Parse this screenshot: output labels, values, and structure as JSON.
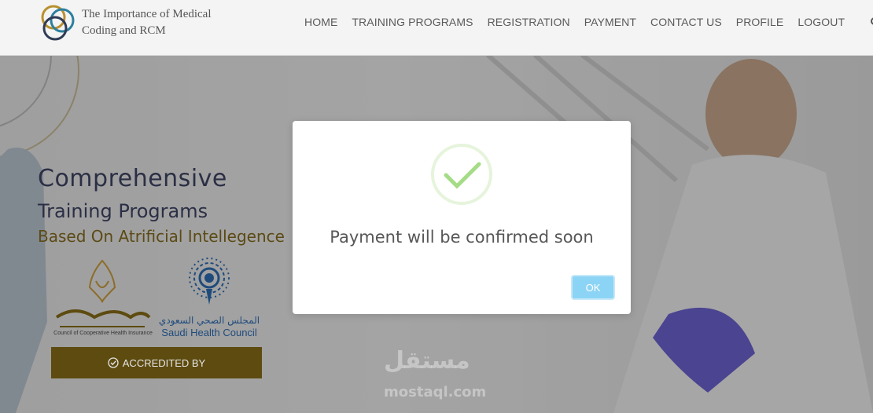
{
  "header": {
    "logo_text": "The Importance of Medical Coding and RCM",
    "nav": [
      "HOME",
      "TRAINING PROGRAMS",
      "REGISTRATION",
      "PAYMENT",
      "CONTACT US",
      "PROFILE",
      "LOGOUT"
    ],
    "search_icon": "search-icon"
  },
  "hero": {
    "title": "Comprehensive",
    "subtitle": "Training Programs",
    "ai_line": "Based On Atrificial Intellegence",
    "cchi_caption": "Council of Cooperative Health Insurance",
    "shc_arabic": "المجلس الصحي السعودي",
    "shc_english": "Saudi Health Council",
    "accredited_label": "ACCREDITED BY",
    "watermark_arabic": "مستقل",
    "watermark_english": "mostaql.com"
  },
  "modal": {
    "icon": "success-check-icon",
    "message": "Payment will be confirmed soon",
    "ok_label": "OK"
  },
  "colors": {
    "accent_gold": "#5d4b10",
    "ok_blue": "#8cd4f5",
    "success_green": "#a5dc86"
  }
}
